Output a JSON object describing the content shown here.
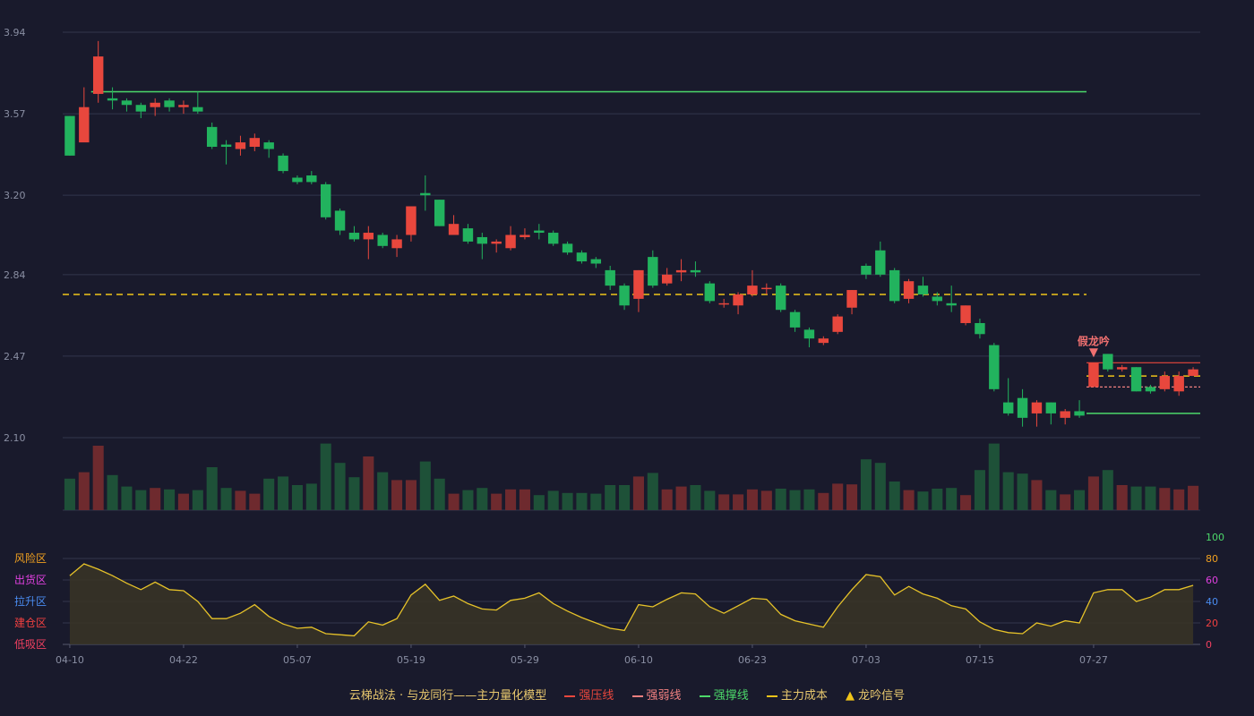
{
  "colors": {
    "background": "#191a2c",
    "up": "#e8473d",
    "down": "#22b35e",
    "up_volume": "#6e2a2e",
    "down_volume": "#1e5138",
    "pressure_line": "#e8473d",
    "weak_line": "#f08080",
    "support_line": "#4cd86a",
    "cost_line": "#f0c419",
    "oscillator_line": "#e6c229",
    "signal_label": "#f07070"
  },
  "legend": {
    "title": "云梯战法 · 与龙同行——主力量化模型",
    "pressure": "强压线",
    "weak": "强弱线",
    "support": "强撑线",
    "cost": "主力成本",
    "signal": "龙吟信号"
  },
  "signal_label": "假龙吟",
  "zones": [
    {
      "label": "风险区",
      "color": "#f0a020"
    },
    {
      "label": "出货区",
      "color": "#e040e0"
    },
    {
      "label": "拉升区",
      "color": "#4a8cf0"
    },
    {
      "label": "建仓区",
      "color": "#f04040"
    },
    {
      "label": "低吸区",
      "color": "#f04060"
    }
  ],
  "chart_data": [
    {
      "type": "candlestick",
      "y_ticks": [
        "3.94",
        "3.57",
        "3.20",
        "2.84",
        "2.47",
        "2.10"
      ],
      "ylim": [
        2.1,
        3.94
      ],
      "x_ticks": [
        "04-10",
        "04-22",
        "05-07",
        "05-19",
        "05-29",
        "06-10",
        "06-23",
        "07-03",
        "07-15",
        "07-27"
      ],
      "x_tick_index": [
        0,
        8,
        16,
        24,
        32,
        40,
        48,
        56,
        64,
        72
      ],
      "candles": [
        [
          3.56,
          3.38,
          3.38,
          3.56
        ],
        [
          3.44,
          3.6,
          3.59,
          3.69
        ],
        [
          3.66,
          3.83,
          3.9,
          3.62
        ],
        [
          3.64,
          3.63,
          3.69,
          3.59
        ],
        [
          3.63,
          3.61,
          3.64,
          3.58
        ],
        [
          3.61,
          3.58,
          3.62,
          3.55
        ],
        [
          3.6,
          3.62,
          3.64,
          3.56
        ],
        [
          3.63,
          3.6,
          3.64,
          3.58
        ],
        [
          3.6,
          3.61,
          3.63,
          3.57
        ],
        [
          3.6,
          3.58,
          3.67,
          3.57
        ],
        [
          3.51,
          3.42,
          3.53,
          3.41
        ],
        [
          3.43,
          3.42,
          3.45,
          3.34
        ],
        [
          3.41,
          3.44,
          3.47,
          3.38
        ],
        [
          3.42,
          3.46,
          3.48,
          3.4
        ],
        [
          3.44,
          3.41,
          3.45,
          3.37
        ],
        [
          3.38,
          3.31,
          3.39,
          3.3
        ],
        [
          3.28,
          3.26,
          3.29,
          3.25
        ],
        [
          3.29,
          3.26,
          3.31,
          3.25
        ],
        [
          3.25,
          3.1,
          3.26,
          3.09
        ],
        [
          3.13,
          3.04,
          3.14,
          3.02
        ],
        [
          3.03,
          3.0,
          3.06,
          2.99
        ],
        [
          3.0,
          3.03,
          3.06,
          2.91
        ],
        [
          3.02,
          2.97,
          3.03,
          2.96
        ],
        [
          2.96,
          3.0,
          3.02,
          2.92
        ],
        [
          3.02,
          3.15,
          3.15,
          2.99
        ],
        [
          3.21,
          3.2,
          3.29,
          3.13
        ],
        [
          3.18,
          3.06,
          3.18,
          3.06
        ],
        [
          3.02,
          3.07,
          3.11,
          3.03
        ],
        [
          3.05,
          2.99,
          3.07,
          2.98
        ],
        [
          3.01,
          2.98,
          3.03,
          2.91
        ],
        [
          2.98,
          2.99,
          3.0,
          2.94
        ],
        [
          2.96,
          3.02,
          3.06,
          2.95
        ],
        [
          3.01,
          3.02,
          3.05,
          3.0
        ],
        [
          3.04,
          3.03,
          3.07,
          3.0
        ],
        [
          3.03,
          2.98,
          3.04,
          2.97
        ],
        [
          2.98,
          2.94,
          2.99,
          2.93
        ],
        [
          2.94,
          2.9,
          2.95,
          2.89
        ],
        [
          2.91,
          2.89,
          2.92,
          2.87
        ],
        [
          2.86,
          2.79,
          2.88,
          2.77
        ],
        [
          2.79,
          2.7,
          2.8,
          2.68
        ],
        [
          2.73,
          2.86,
          2.86,
          2.67
        ],
        [
          2.92,
          2.79,
          2.95,
          2.78
        ],
        [
          2.8,
          2.84,
          2.87,
          2.79
        ],
        [
          2.85,
          2.86,
          2.91,
          2.81
        ],
        [
          2.86,
          2.85,
          2.9,
          2.83
        ],
        [
          2.8,
          2.72,
          2.81,
          2.71
        ],
        [
          2.71,
          2.71,
          2.73,
          2.69
        ],
        [
          2.7,
          2.75,
          2.76,
          2.66
        ],
        [
          2.75,
          2.79,
          2.86,
          2.74
        ],
        [
          2.78,
          2.78,
          2.8,
          2.75
        ],
        [
          2.79,
          2.68,
          2.8,
          2.67
        ],
        [
          2.67,
          2.6,
          2.68,
          2.58
        ],
        [
          2.59,
          2.55,
          2.6,
          2.51
        ],
        [
          2.53,
          2.55,
          2.56,
          2.52
        ],
        [
          2.58,
          2.65,
          2.66,
          2.57
        ],
        [
          2.69,
          2.77,
          2.77,
          2.66
        ],
        [
          2.88,
          2.84,
          2.89,
          2.82
        ],
        [
          2.95,
          2.84,
          2.99,
          2.83
        ],
        [
          2.86,
          2.72,
          2.87,
          2.71
        ],
        [
          2.73,
          2.81,
          2.82,
          2.71
        ],
        [
          2.79,
          2.75,
          2.83,
          2.74
        ],
        [
          2.74,
          2.72,
          2.76,
          2.7
        ],
        [
          2.71,
          2.7,
          2.79,
          2.67
        ],
        [
          2.62,
          2.7,
          2.7,
          2.61
        ],
        [
          2.62,
          2.57,
          2.64,
          2.55
        ],
        [
          2.52,
          2.32,
          2.53,
          2.31
        ],
        [
          2.26,
          2.21,
          2.37,
          2.2
        ],
        [
          2.28,
          2.19,
          2.32,
          2.15
        ],
        [
          2.21,
          2.26,
          2.27,
          2.15
        ],
        [
          2.26,
          2.21,
          2.26,
          2.16
        ],
        [
          2.19,
          2.22,
          2.23,
          2.16
        ],
        [
          2.22,
          2.2,
          2.27,
          2.19
        ],
        [
          2.33,
          2.44,
          2.44,
          2.33
        ],
        [
          2.48,
          2.41,
          2.48,
          2.4
        ],
        [
          2.41,
          2.42,
          2.43,
          2.4
        ],
        [
          2.42,
          2.31,
          2.42,
          2.31
        ],
        [
          2.33,
          2.31,
          2.34,
          2.3
        ],
        [
          2.32,
          2.38,
          2.4,
          2.31
        ],
        [
          2.31,
          2.38,
          2.4,
          2.29
        ],
        [
          2.38,
          2.41,
          2.42,
          2.38
        ]
      ],
      "volume": [
        44,
        53,
        90,
        49,
        33,
        28,
        31,
        29,
        23,
        28,
        60,
        31,
        27,
        23,
        44,
        47,
        35,
        37,
        93,
        66,
        46,
        75,
        53,
        42,
        42,
        68,
        44,
        23,
        28,
        31,
        23,
        29,
        29,
        21,
        27,
        24,
        24,
        23,
        35,
        35,
        47,
        52,
        29,
        33,
        35,
        27,
        22,
        22,
        29,
        27,
        30,
        28,
        29,
        24,
        37,
        36,
        71,
        66,
        40,
        28,
        26,
        30,
        31,
        21,
        56,
        93,
        53,
        51,
        42,
        28,
        22,
        28,
        47,
        56,
        35,
        33,
        33,
        31,
        29,
        34
      ],
      "volume_ymax": 100,
      "pressure_line": {
        "from": 2,
        "to": 71,
        "y": 3.67
      },
      "pressure_line_2": {
        "from": 72,
        "to": 79,
        "y": 2.44
      },
      "weak_line": {
        "from": 72,
        "to": 79,
        "y": 2.33
      },
      "support_line": {
        "from": 72,
        "to": 79,
        "y": 2.21
      },
      "cost_line": {
        "from": 0,
        "to": 71,
        "y": 2.75
      },
      "cost_line_2": {
        "from": 72,
        "to": 79,
        "y": 2.38
      },
      "signal_index": 72,
      "oscillator_ticks": [
        "100",
        "80",
        "60",
        "40",
        "20",
        "0"
      ],
      "oscillator": [
        64,
        75,
        70,
        64,
        57,
        51,
        58,
        51,
        50,
        40,
        24,
        24,
        29,
        37,
        26,
        19,
        15,
        16,
        10,
        9,
        8,
        21,
        18,
        24,
        46,
        56,
        41,
        45,
        38,
        33,
        32,
        41,
        43,
        48,
        38,
        31,
        25,
        20,
        15,
        13,
        37,
        35,
        42,
        48,
        47,
        35,
        29,
        36,
        43,
        42,
        28,
        22,
        19,
        16,
        35,
        51,
        65,
        63,
        46,
        54,
        47,
        43,
        36,
        33,
        21,
        14,
        11,
        10,
        20,
        17,
        22,
        20,
        48,
        51,
        51,
        40,
        44,
        51,
        51,
        55
      ],
      "oscillator_ylim": [
        0,
        100
      ]
    }
  ]
}
